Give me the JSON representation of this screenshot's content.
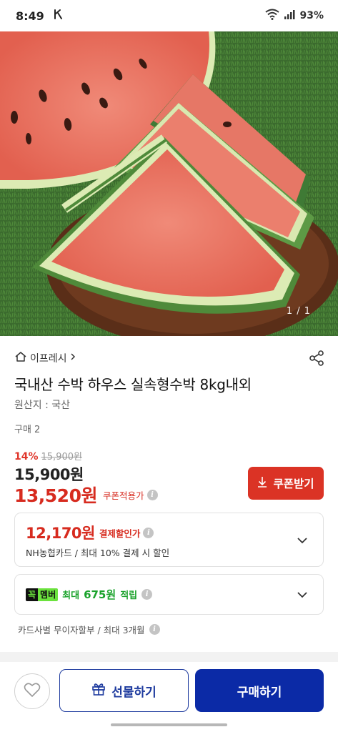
{
  "status_bar": {
    "time": "8:49",
    "battery": "93%"
  },
  "hero": {
    "page_indicator": "1 / 1"
  },
  "product": {
    "store_name": "이프레시",
    "title": "국내산 수박 하우스 실속형수박 8kg내외",
    "origin": "원산지 : 국산",
    "purchase_count": "구매 2",
    "discount_rate": "14%",
    "original_price": "15,900원",
    "sale_price": "15,900원",
    "coupon_price": "13,520원",
    "coupon_applied_label": "쿠폰적용가",
    "coupon_button_label": "쿠폰받기"
  },
  "payment_discount": {
    "price": "12,170원",
    "label": "결제할인가",
    "description": "NH농협카드 / 최대 10% 결제 시 할인"
  },
  "membership": {
    "badge_part1": "꼭",
    "badge_part2": "멤버",
    "prefix": "최대",
    "amount": "675원",
    "suffix": "적립"
  },
  "installment": {
    "text": "카드사별 무이자할부 / 최대 3개월"
  },
  "bottom_bar": {
    "gift_label": "선물하기",
    "buy_label": "구매하기"
  },
  "colors": {
    "accent_red": "#d72b1f",
    "primary_blue": "#0b2aa6",
    "member_green": "#1aa22b"
  }
}
